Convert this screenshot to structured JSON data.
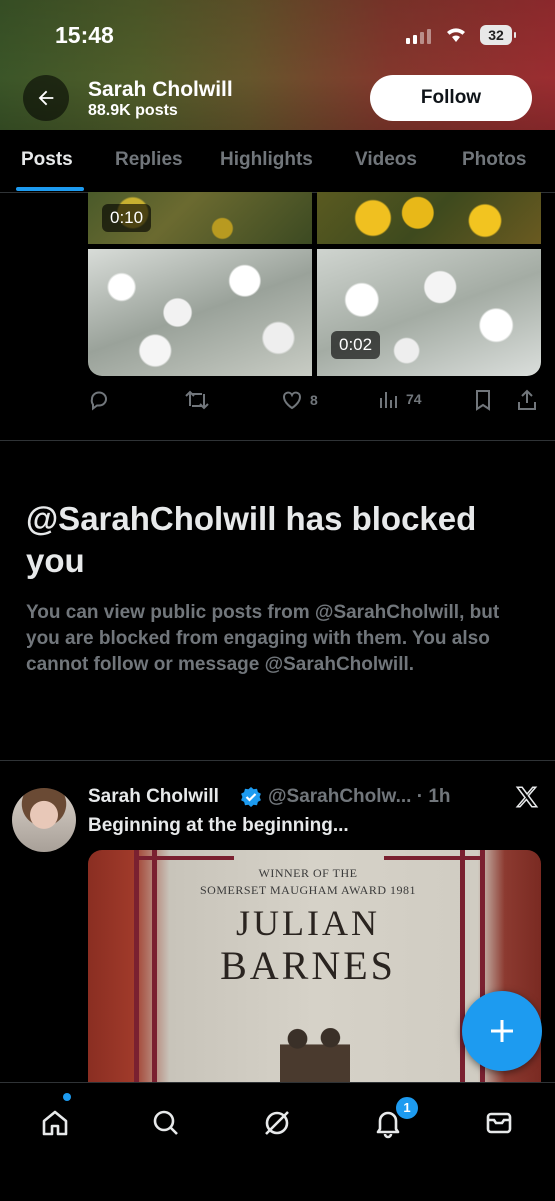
{
  "status_bar": {
    "time": "15:48",
    "battery": "32"
  },
  "profile": {
    "name": "Sarah Cholwill",
    "post_count": "88.9K posts",
    "follow_label": "Follow"
  },
  "tabs": [
    {
      "label": "Posts",
      "active": true
    },
    {
      "label": "Replies"
    },
    {
      "label": "Highlights"
    },
    {
      "label": "Videos"
    },
    {
      "label": "Photos"
    }
  ],
  "media_post": {
    "video_durations": [
      "0:10",
      "0:02"
    ],
    "likes": "8",
    "views": "74"
  },
  "blocked": {
    "title": "@SarahCholwill has blocked you",
    "message": "You can view public posts from @SarahCholwill, but you are blocked from engaging with them. You also cannot follow or message @SarahCholwill."
  },
  "tweet": {
    "name": "Sarah Cholwill",
    "handle_time": "@SarahCholw... · 1h",
    "text": "Beginning at the beginning...",
    "book": {
      "award_line1": "WINNER OF THE",
      "award_line2": "SOMERSET MAUGHAM AWARD 1981",
      "author_first": "JULIAN",
      "author_last": "BARNES"
    }
  },
  "bottom_nav": {
    "notification_count": "1"
  },
  "colors": {
    "accent": "#1d9bf0",
    "background": "#000000",
    "muted": "#71767b",
    "text": "#e7e9ea"
  }
}
